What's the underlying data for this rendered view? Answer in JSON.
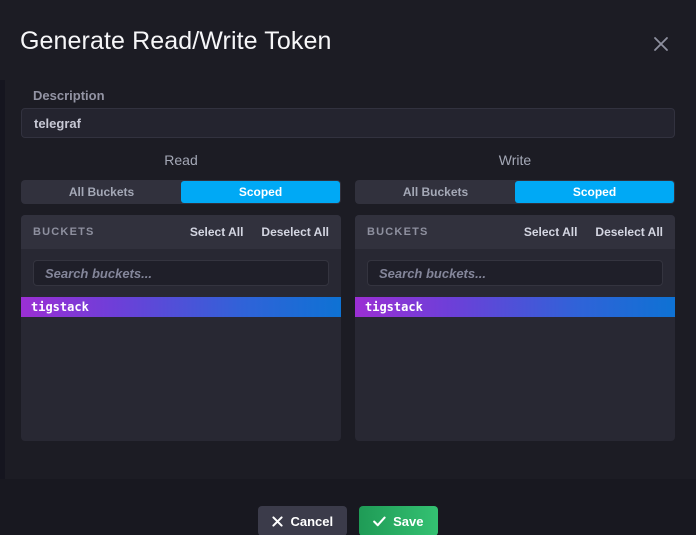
{
  "modal": {
    "title": "Generate Read/Write Token",
    "close_icon": "close-icon"
  },
  "description": {
    "label": "Description",
    "value": "telegraf",
    "placeholder": ""
  },
  "permissions": [
    {
      "key": "read",
      "title": "Read",
      "toggle": {
        "options": [
          "All Buckets",
          "Scoped"
        ],
        "selected": "Scoped"
      },
      "buckets_panel": {
        "header": "BUCKETS",
        "select_all": "Select All",
        "deselect_all": "Deselect All",
        "search_placeholder": "Search buckets...",
        "search_value": "",
        "items": [
          {
            "name": "tigstack",
            "selected": true
          }
        ]
      }
    },
    {
      "key": "write",
      "title": "Write",
      "toggle": {
        "options": [
          "All Buckets",
          "Scoped"
        ],
        "selected": "Scoped"
      },
      "buckets_panel": {
        "header": "BUCKETS",
        "select_all": "Select All",
        "deselect_all": "Deselect All",
        "search_placeholder": "Search buckets...",
        "search_value": "",
        "items": [
          {
            "name": "tigstack",
            "selected": true
          }
        ]
      }
    }
  ],
  "footer": {
    "cancel_label": "Cancel",
    "save_label": "Save",
    "cancel_icon": "x-icon",
    "save_icon": "check-icon"
  },
  "colors": {
    "accent_blue": "#00a9f5",
    "save_green": "#2a9d5f",
    "bucket_gradient_start": "#9b2fd4",
    "bucket_gradient_end": "#0e72d4",
    "modal_bg": "#1c1c24",
    "footer_bg": "#181820"
  }
}
